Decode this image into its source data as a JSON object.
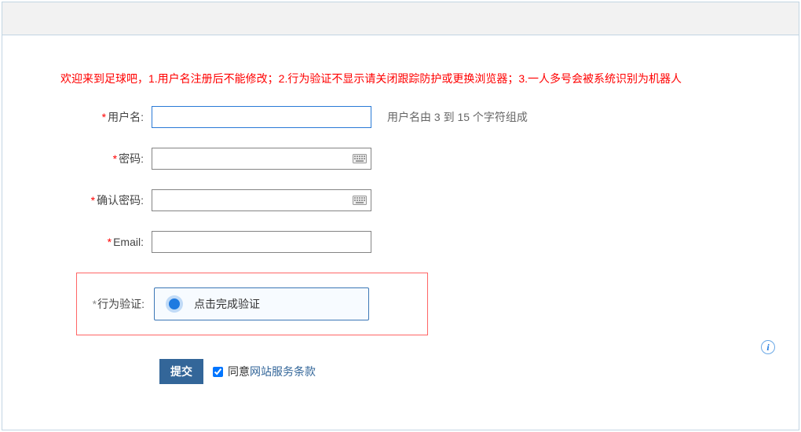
{
  "welcome": "欢迎来到足球吧，1.用户名注册后不能修改；2.行为验证不显示请关闭跟踪防护或更换浏览器；3.一人多号会被系统识别为机器人",
  "fields": {
    "username": {
      "label": "用户名:",
      "value": "",
      "hint": "用户名由 3 到 15 个字符组成"
    },
    "password": {
      "label": "密码:",
      "value": ""
    },
    "confirm": {
      "label": "确认密码:",
      "value": ""
    },
    "email": {
      "label": "Email:",
      "value": ""
    },
    "captcha": {
      "label": "行为验证:",
      "button_text": "点击完成验证"
    }
  },
  "submit": {
    "label": "提交"
  },
  "agree": {
    "checked": true,
    "prefix": "同意",
    "link_text": "网站服务条款"
  },
  "info_icon": "i"
}
